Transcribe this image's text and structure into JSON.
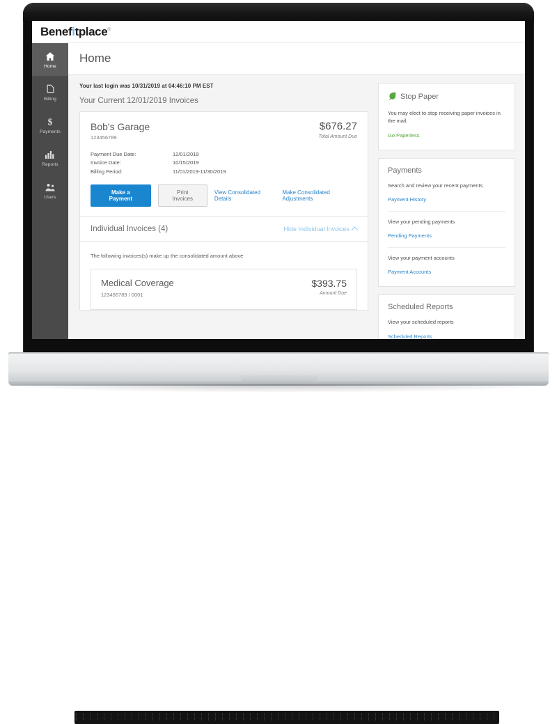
{
  "brand": {
    "name_part1": "Benef",
    "name_dot": "i",
    "name_part2": "tplace",
    "trademark": "®",
    "dot_color": "#7ab8e8"
  },
  "sidebar": {
    "items": [
      {
        "label": "Home",
        "icon": "home-icon",
        "active": true
      },
      {
        "label": "Billing",
        "icon": "billing-icon",
        "active": false
      },
      {
        "label": "Payments",
        "icon": "dollar-icon",
        "active": false
      },
      {
        "label": "Reports",
        "icon": "bar-chart-icon",
        "active": false
      },
      {
        "label": "Users",
        "icon": "users-icon",
        "active": false
      }
    ]
  },
  "header": {
    "title": "Home"
  },
  "main": {
    "login_note": "Your last login was 10/31/2019 at 04:46:10 PM EST",
    "section_title": "Your Current 12/01/2019 Invoices",
    "invoice": {
      "name": "Bob's Garage",
      "account": "123456789",
      "amount": "$676.27",
      "amount_label": "Total Amount Due",
      "details": [
        {
          "key": "Payment Due Date:",
          "value": "12/01/2019"
        },
        {
          "key": "Invoice Date:",
          "value": "10/15/2019"
        },
        {
          "key": "Billing Period:",
          "value": "11/01/2019-11/30/2019"
        }
      ],
      "actions": {
        "primary": "Make a Payment",
        "secondary": "Print Invoices",
        "link1": "View Consolidated Details",
        "link2": "Make Consolidated Adjustments"
      }
    },
    "individual": {
      "title": "Individual Invoices (4)",
      "toggle": "Hide Individual Invoices",
      "note": "The following invoices(s) make up the consolidated amount above",
      "items": [
        {
          "name": "Medical Coverage",
          "account": "123456789 / 0001",
          "amount": "$393.75",
          "amount_label": "Amount Due"
        }
      ]
    }
  },
  "widgets": [
    {
      "title": "Stop Paper",
      "icon": "leaf-icon",
      "rows": [
        {
          "text": "You may elect to stop receiving paper invoices in the mail.",
          "link": "Go Paperless",
          "link_style": "green"
        }
      ]
    },
    {
      "title": "Payments",
      "icon": "",
      "rows": [
        {
          "text": "Search and review your recent payments",
          "link": "Payment History",
          "link_style": "blue"
        },
        {
          "text": "View your pending payments",
          "link": "Pending Payments",
          "link_style": "blue"
        },
        {
          "text": "View your payment accounts",
          "link": "Payment Accounts",
          "link_style": "blue"
        }
      ]
    },
    {
      "title": "Scheduled Reports",
      "icon": "",
      "rows": [
        {
          "text": "View your scheduled reports",
          "link": "Scheduled Reports",
          "link_style": "blue"
        }
      ]
    }
  ],
  "colors": {
    "accent_blue": "#1a86d0",
    "link_blue": "#2a84c8",
    "light_blue": "#8dc6ec",
    "green": "#56a83c",
    "sidebar_bg": "#4a4a4a",
    "sidebar_active": "#5c5c5c",
    "page_bg": "#f4f4f4"
  }
}
